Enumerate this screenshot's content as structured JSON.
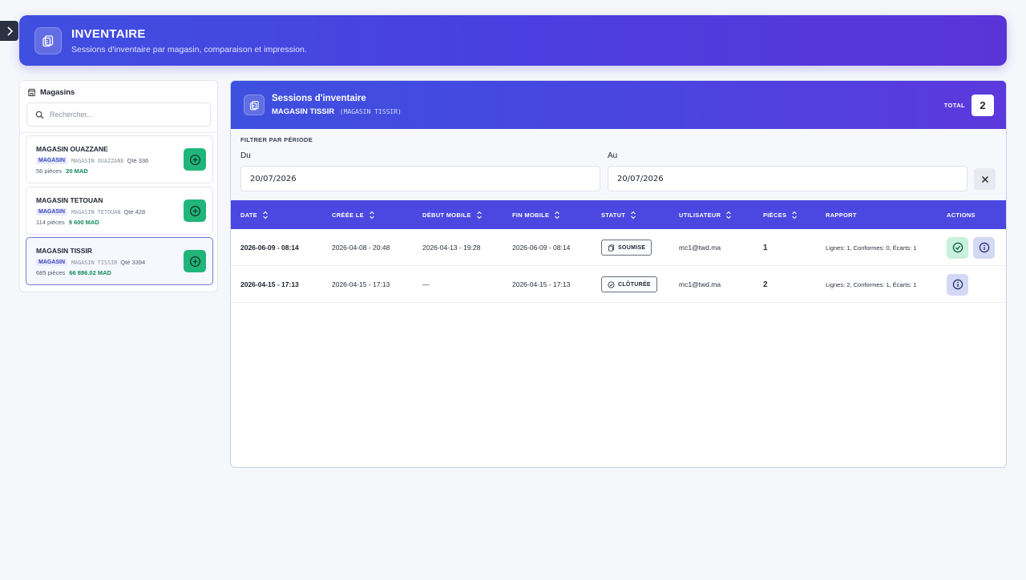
{
  "header": {
    "title": "INVENTAIRE",
    "subtitle": "Sessions d'inventaire par magasin, comparaison et impression."
  },
  "stores_panel": {
    "title": "Magasins",
    "search_placeholder": "Rechercher...",
    "stores": [
      {
        "name": "MAGASIN OUAZZANE",
        "tag": "MAGASIN",
        "code": "MAGASIN OUAZZANE",
        "qty": "Qté 336",
        "pieces": "56 pièces",
        "amount": "20 MAD"
      },
      {
        "name": "MAGASIN TETOUAN",
        "tag": "MAGASIN",
        "code": "MAGASIN TETOUAN",
        "qty": "Qté 428",
        "pieces": "114 pièces",
        "amount": "9 600 MAD"
      },
      {
        "name": "MAGASIN TISSIR",
        "tag": "MAGASIN",
        "code": "MAGASIN TISSIR",
        "qty": "Qté 3394",
        "pieces": "685 pièces",
        "amount": "66 886.02 MAD"
      }
    ],
    "selected_index": 2
  },
  "sessions": {
    "title": "Sessions d'inventaire",
    "store_name": "MAGASIN TISSIR",
    "store_code": "(MAGASIN TISSIR)",
    "total_label": "TOTAL",
    "total_value": "2",
    "filter": {
      "title": "FILTRER PAR PÉRIODE",
      "from_label": "Du",
      "from_value": "20/07/2026",
      "to_label": "Au",
      "to_value": "20/07/2026"
    },
    "columns": [
      "DATE",
      "CRÉÉE LE",
      "DÉBUT MOBILE",
      "FIN MOBILE",
      "STATUT",
      "UTILISATEUR",
      "PIÈCES",
      "RAPPORT",
      "ACTIONS"
    ],
    "rows": [
      {
        "date": "2026-06-09 - 08:14",
        "created": "2026-04-08 - 20:48",
        "mobile_start": "2026-04-13 - 19:28",
        "mobile_end": "2026-06-09 - 08:14",
        "status": "SOUMISE",
        "user": "mc1@twd.ma",
        "pieces": "1",
        "report": "Lignes: 1, Conformes: 0, Écarts: 1"
      },
      {
        "date": "2026-04-15 - 17:13",
        "created": "2026-04-15 - 17:13",
        "mobile_start": "—",
        "mobile_end": "2026-04-15 - 17:13",
        "status": "CLÔTURÉE",
        "user": "mc1@twd.ma",
        "pieces": "2",
        "report": "Lignes: 2, Conformes: 1, Écarts: 1"
      }
    ]
  },
  "colors": {
    "accent": "#4a48e0",
    "success": "#21b57a",
    "amount": "#128a57"
  },
  "icons": {
    "sidebar_toggle": "chevron-right-icon",
    "header": "clipboard-copy-icon",
    "stores": "store-icon",
    "search": "search-icon",
    "store_action": "plus-circle-icon",
    "clear": "close-icon",
    "sort": "sort-icon",
    "submitted": "clipboard-icon",
    "closed": "check-circle-icon",
    "approve": "check-circle-icon",
    "details": "info-icon"
  }
}
